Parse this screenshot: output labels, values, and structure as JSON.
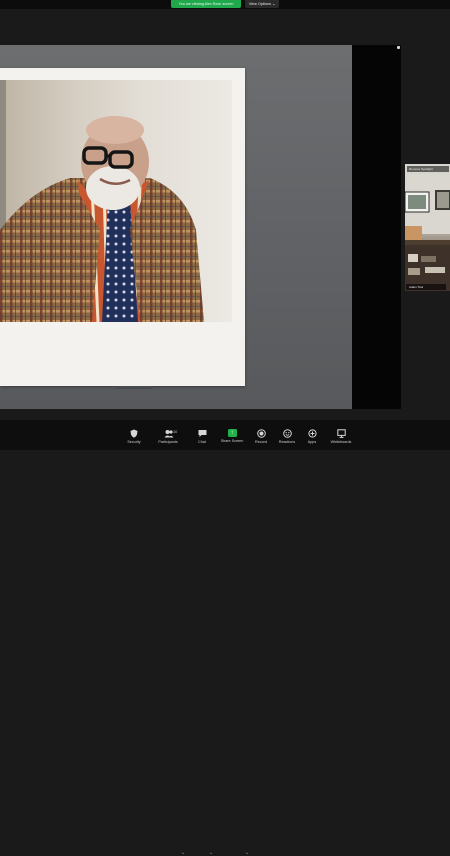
{
  "top_bar": {
    "share_notice": "You are viewing Alex Ross' screen",
    "view_options": "View Options ⌄"
  },
  "participant": {
    "spotlight_label": "Remove Spotlight",
    "name": "Adam Tool"
  },
  "toolbar": {
    "security": "Security",
    "participants": "Participants",
    "participants_count": "10",
    "chat": "Chat",
    "share_screen": "Share Screen",
    "record": "Record",
    "reactions": "Reactions",
    "apps": "Apps",
    "whiteboards": "Whiteboards"
  },
  "icons": {
    "security": "shield-icon",
    "participants": "people-icon",
    "chat": "chat-bubble-icon",
    "share_screen": "share-arrow-icon",
    "record": "record-icon",
    "reactions": "smiley-icon",
    "apps": "apps-icon",
    "whiteboards": "whiteboard-icon"
  },
  "colors": {
    "share_green": "#22b24c",
    "toolbar_bg": "#0e0e0e",
    "stage_bg": "#1a1a1a"
  }
}
